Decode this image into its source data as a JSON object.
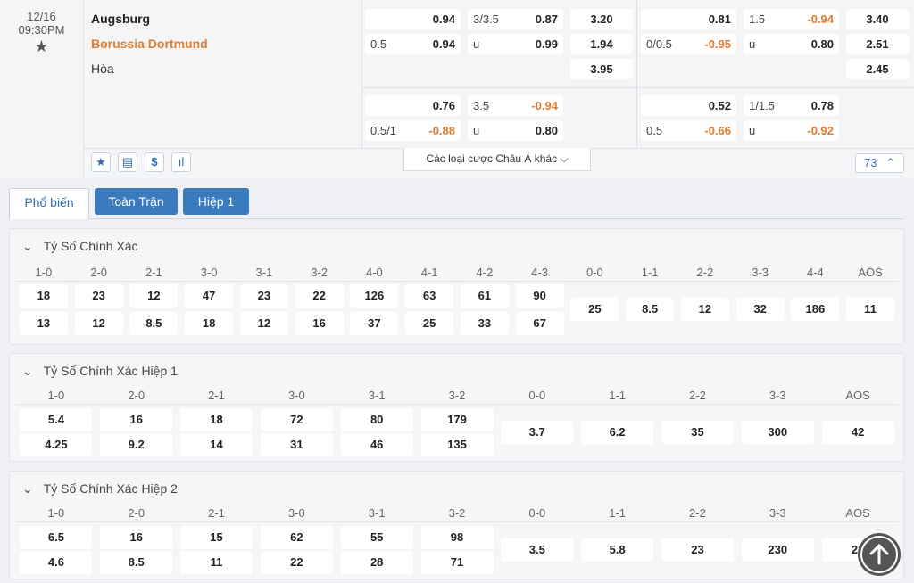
{
  "match": {
    "date": "12/16",
    "time": "09:30PM",
    "home": "Augsburg",
    "away": "Borussia Dortmund",
    "draw": "Hòa"
  },
  "ft": {
    "hdp": [
      {
        "l": "",
        "r": "0.94"
      },
      {
        "l": "0.5",
        "r": "0.94"
      }
    ],
    "ou": [
      {
        "l": "3/3.5",
        "r": "0.87"
      },
      {
        "l": "u",
        "r": "0.99"
      }
    ],
    "x12": [
      "3.20",
      "1.94",
      "3.95"
    ],
    "hdp2": [
      {
        "l": "",
        "r": "0.76"
      },
      {
        "l": "0.5/1",
        "r": "-0.88"
      }
    ],
    "ou2": [
      {
        "l": "3.5",
        "r": "-0.94"
      },
      {
        "l": "u",
        "r": "0.80"
      }
    ]
  },
  "ht": {
    "hdp": [
      {
        "l": "",
        "r": "0.81"
      },
      {
        "l": "0/0.5",
        "r": "-0.95"
      }
    ],
    "ou": [
      {
        "l": "1.5",
        "r": "-0.94"
      },
      {
        "l": "u",
        "r": "0.80"
      }
    ],
    "x12": [
      "3.40",
      "2.51",
      "2.45"
    ],
    "hdp2": [
      {
        "l": "",
        "r": "0.52"
      },
      {
        "l": "0.5",
        "r": "-0.66"
      }
    ],
    "ou2": [
      {
        "l": "1/1.5",
        "r": "0.78"
      },
      {
        "l": "u",
        "r": "-0.92"
      }
    ]
  },
  "more_label": "Các loại cược Châu Á khác",
  "more_count": "73",
  "tabs": [
    "Phổ biến",
    "Toàn Trận",
    "Hiệp 1"
  ],
  "sections": [
    {
      "title": "Tỷ Số Chính Xác",
      "headers": [
        "1-0",
        "2-0",
        "2-1",
        "3-0",
        "3-1",
        "3-2",
        "4-0",
        "4-1",
        "4-2",
        "4-3",
        "0-0",
        "1-1",
        "2-2",
        "3-3",
        "4-4",
        "AOS"
      ],
      "row1": [
        "18",
        "23",
        "12",
        "47",
        "23",
        "22",
        "126",
        "63",
        "61",
        "90"
      ],
      "row2": [
        "13",
        "12",
        "8.5",
        "18",
        "12",
        "16",
        "37",
        "25",
        "33",
        "67"
      ],
      "single": [
        "25",
        "8.5",
        "12",
        "32",
        "186",
        "11"
      ]
    },
    {
      "title": "Tỷ Số Chính Xác Hiệp 1",
      "headers": [
        "1-0",
        "2-0",
        "2-1",
        "3-0",
        "3-1",
        "3-2",
        "0-0",
        "1-1",
        "2-2",
        "3-3",
        "AOS"
      ],
      "row1": [
        "5.4",
        "16",
        "18",
        "72",
        "80",
        "179"
      ],
      "row2": [
        "4.25",
        "9.2",
        "14",
        "31",
        "46",
        "135"
      ],
      "single": [
        "3.7",
        "6.2",
        "35",
        "300",
        "42"
      ]
    },
    {
      "title": "Tỷ Số Chính Xác Hiệp 2",
      "headers": [
        "1-0",
        "2-0",
        "2-1",
        "3-0",
        "3-1",
        "3-2",
        "0-0",
        "1-1",
        "2-2",
        "3-3",
        "AOS"
      ],
      "row1": [
        "6.5",
        "16",
        "15",
        "62",
        "55",
        "98"
      ],
      "row2": [
        "4.6",
        "8.5",
        "11",
        "22",
        "28",
        "71"
      ],
      "single": [
        "3.5",
        "5.8",
        "23",
        "230",
        "22"
      ]
    }
  ],
  "colors": {
    "accent": "#2f6db5",
    "negative": "#e07b30",
    "tabActiveBg": "#3a7bbf"
  }
}
